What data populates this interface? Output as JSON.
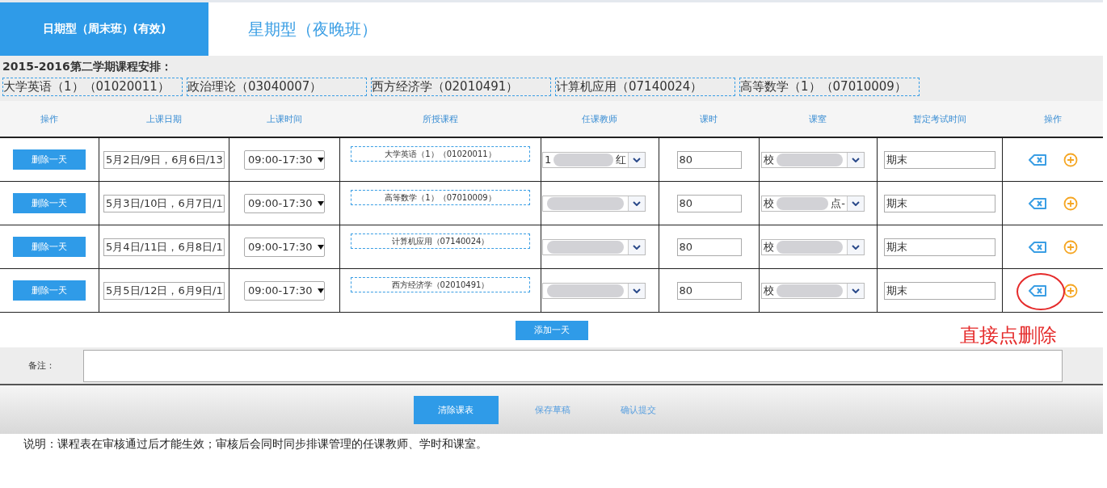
{
  "tabs": [
    {
      "label": "日期型（周末班）(有效)",
      "selected": true
    },
    {
      "label": "星期型（夜晚班）",
      "selected": false
    }
  ],
  "semester": {
    "title": "2015-2016第二学期课程安排：",
    "courses": [
      "大学英语（1）（01020011）",
      "政治理论（03040007）",
      "西方经济学（02010491）",
      "计算机应用（07140024）",
      "高等数学（1）（07010009）"
    ]
  },
  "table": {
    "columns": [
      "操作",
      "上课日期",
      "上课时间",
      "所授课程",
      "任课教师",
      "课时",
      "课室",
      "暂定考试时间",
      "操作"
    ],
    "rows": [
      {
        "delete_label": "删除一天",
        "dates": "5月2日/9日，6月6日/13",
        "time": "09:00-17:30",
        "course": "大学英语（1）（01020011）",
        "teacher_start": "1",
        "teacher_end": "红",
        "hours": "80",
        "room_start": "校",
        "room_end": "",
        "exam": "期末",
        "circled": false
      },
      {
        "delete_label": "删除一天",
        "dates": "5月3日/10日，6月7日/1",
        "time": "09:00-17:30",
        "course": "高等数学（1）（07010009）",
        "teacher_start": "",
        "teacher_end": "",
        "hours": "80",
        "room_start": "校",
        "room_end": "点-",
        "exam": "期末",
        "circled": false
      },
      {
        "delete_label": "删除一天",
        "dates": "5月4日/11日，6月8日/1",
        "time": "09:00-17:30",
        "course": "计算机应用（07140024）",
        "teacher_start": "",
        "teacher_end": "",
        "hours": "80",
        "room_start": "校",
        "room_end": "",
        "exam": "期末",
        "circled": false
      },
      {
        "delete_label": "删除一天",
        "dates": "5月5日/12日，6月9日/1",
        "time": "09:00-17:30",
        "course": "西方经济学（02010491）",
        "teacher_start": "",
        "teacher_end": "",
        "hours": "80",
        "room_start": "校",
        "room_end": "",
        "exam": "期末",
        "circled": true
      }
    ]
  },
  "add_button": "添加一天",
  "annotation": "直接点删除",
  "remarks": {
    "label": "备注："
  },
  "footer_buttons": [
    {
      "label": "清除课表",
      "selected": true
    },
    {
      "label": "保存草稿",
      "selected": false
    },
    {
      "label": "确认提交",
      "selected": false
    }
  ],
  "note": "说明：课程表在审核通过后才能生效；审核后会同时同步排课管理的任课教师、学时和课室。"
}
